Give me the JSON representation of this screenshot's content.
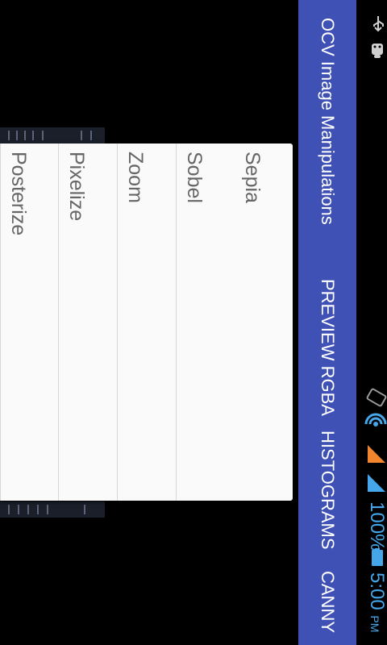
{
  "app": {
    "title": "OCV Image Manipulations"
  },
  "actions": [
    {
      "label": "PREVIEW RGBA"
    },
    {
      "label": "HISTOGRAMS"
    },
    {
      "label": "CANNY"
    }
  ],
  "menu": {
    "items": [
      {
        "label": "Sepia"
      },
      {
        "label": "Sobel"
      },
      {
        "label": "Zoom"
      },
      {
        "label": "Pixelize"
      },
      {
        "label": "Posterize"
      }
    ]
  },
  "status_bar": {
    "time": "5:00",
    "ampm": "PM",
    "battery_percent": "100%",
    "icons": [
      "usb-icon",
      "android-debug-icon",
      "rotate-icon",
      "wifi-icon",
      "mobile-signal-icon",
      "cell-signal-icon",
      "battery-icon"
    ],
    "accent_color": "#45a6ea"
  },
  "colors": {
    "action_bar": "#3f51b5",
    "menu_background": "#fafafa",
    "menu_text": "#666666"
  }
}
